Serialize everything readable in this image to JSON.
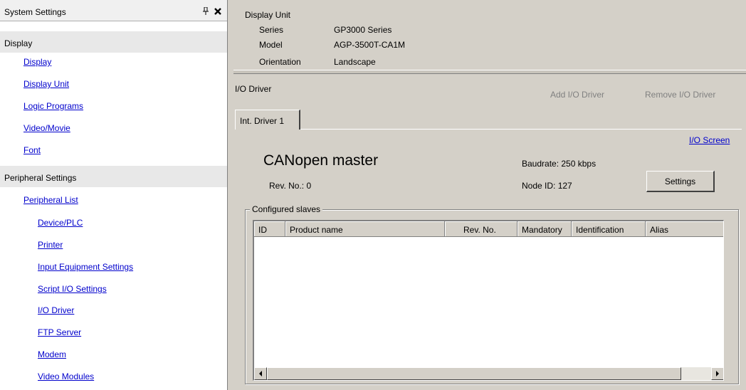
{
  "left_panel": {
    "title": "System Settings",
    "pin_glyph": "I",
    "close_glyph": "✖",
    "display_section": {
      "header": "Display",
      "items": [
        "Display",
        "Display Unit",
        "Logic Programs",
        "Video/Movie",
        "Font"
      ]
    },
    "peripheral_section": {
      "header": "Peripheral Settings",
      "items": [
        "Peripheral List",
        "Device/PLC",
        "Printer",
        "Input Equipment Settings",
        "Script I/O Settings",
        "I/O Driver",
        "FTP Server",
        "Modem",
        "Video Modules"
      ]
    }
  },
  "display_unit": {
    "heading": "Display Unit",
    "series_label": "Series",
    "series_value": "GP3000 Series",
    "model_label": "Model",
    "model_value": "AGP-3500T-CA1M",
    "orientation_label": "Orientation",
    "orientation_value": "Landscape"
  },
  "io_driver": {
    "heading": "I/O Driver",
    "add_label": "Add I/O Driver",
    "remove_label": "Remove I/O Driver",
    "tab_label": "Int. Driver 1",
    "io_screen_link": "I/O Screen",
    "driver_name": "CANopen master",
    "rev_no": "Rev. No.: 0",
    "baudrate": "Baudrate: 250 kbps",
    "node_id": "Node ID: 127",
    "settings_button": "Settings",
    "slaves_legend": "Configured slaves",
    "columns": [
      "ID",
      "Product name",
      "Rev. No.",
      "Mandatory",
      "Identification",
      "Alias"
    ]
  },
  "colors": {
    "link": "#0000cc",
    "disabled": "#808080",
    "face": "#d4d0c8"
  }
}
